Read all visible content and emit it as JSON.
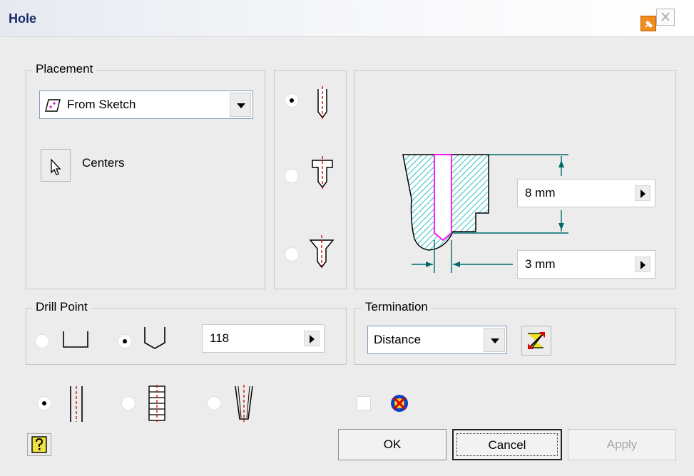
{
  "window": {
    "title": "Hole"
  },
  "placement": {
    "legend": "Placement",
    "select_value": "From Sketch",
    "centers_label": "Centers"
  },
  "hole_types": {
    "selected": "simple"
  },
  "dimensions": {
    "depth": "8 mm",
    "diameter": "3 mm"
  },
  "drill_point": {
    "legend": "Drill Point",
    "selected": "angled",
    "angle": "118"
  },
  "termination": {
    "legend": "Termination",
    "select_value": "Distance"
  },
  "thread_options": {
    "selected": "drilled"
  },
  "buttons": {
    "ok": "OK",
    "cancel": "Cancel",
    "apply": "Apply"
  },
  "colors": {
    "accent_red": "#d00000",
    "hatch_cyan": "#30c0c0",
    "dim_teal": "#006a6a",
    "outline_magenta": "#ff00ff"
  }
}
